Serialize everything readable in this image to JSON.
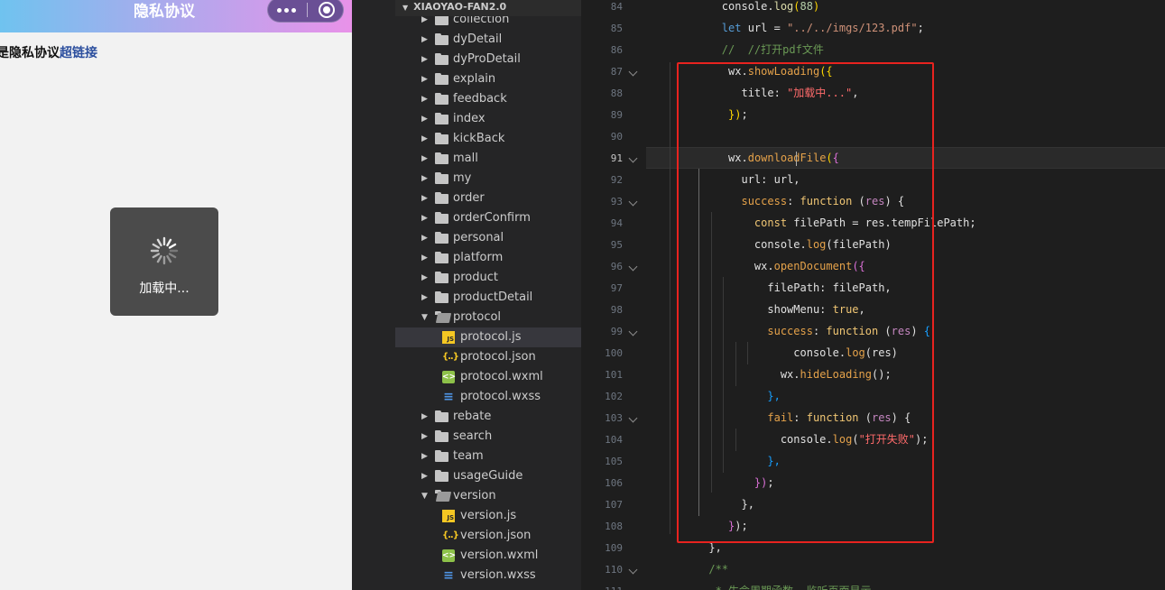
{
  "simulator": {
    "nav_title": "隐私协议",
    "back_glyph": "‹",
    "page_text": "是隐私协议",
    "page_link": "超链接",
    "toast_text": "加载中..."
  },
  "explorer": {
    "project_title": "XIAOYAO-FAN2.0",
    "items": [
      {
        "label": "collection",
        "type": "folder",
        "depth": 0,
        "open": false
      },
      {
        "label": "dyDetail",
        "type": "folder",
        "depth": 0,
        "open": false
      },
      {
        "label": "dyProDetail",
        "type": "folder",
        "depth": 0,
        "open": false
      },
      {
        "label": "explain",
        "type": "folder",
        "depth": 0,
        "open": false
      },
      {
        "label": "feedback",
        "type": "folder",
        "depth": 0,
        "open": false
      },
      {
        "label": "index",
        "type": "folder",
        "depth": 0,
        "open": false
      },
      {
        "label": "kickBack",
        "type": "folder",
        "depth": 0,
        "open": false
      },
      {
        "label": "mall",
        "type": "folder",
        "depth": 0,
        "open": false
      },
      {
        "label": "my",
        "type": "folder",
        "depth": 0,
        "open": false
      },
      {
        "label": "order",
        "type": "folder",
        "depth": 0,
        "open": false
      },
      {
        "label": "orderConfirm",
        "type": "folder",
        "depth": 0,
        "open": false
      },
      {
        "label": "personal",
        "type": "folder",
        "depth": 0,
        "open": false
      },
      {
        "label": "platform",
        "type": "folder",
        "depth": 0,
        "open": false
      },
      {
        "label": "product",
        "type": "folder",
        "depth": 0,
        "open": false
      },
      {
        "label": "productDetail",
        "type": "folder",
        "depth": 0,
        "open": false
      },
      {
        "label": "protocol",
        "type": "folder",
        "depth": 0,
        "open": true
      },
      {
        "label": "protocol.js",
        "type": "js",
        "depth": 1,
        "selected": true
      },
      {
        "label": "protocol.json",
        "type": "json",
        "depth": 1
      },
      {
        "label": "protocol.wxml",
        "type": "wxml",
        "depth": 1
      },
      {
        "label": "protocol.wxss",
        "type": "wxss",
        "depth": 1
      },
      {
        "label": "rebate",
        "type": "folder",
        "depth": 0,
        "open": false
      },
      {
        "label": "search",
        "type": "folder",
        "depth": 0,
        "open": false
      },
      {
        "label": "team",
        "type": "folder",
        "depth": 0,
        "open": false
      },
      {
        "label": "usageGuide",
        "type": "folder",
        "depth": 0,
        "open": false
      },
      {
        "label": "version",
        "type": "folder",
        "depth": 0,
        "open": true
      },
      {
        "label": "version.js",
        "type": "js",
        "depth": 1
      },
      {
        "label": "version.json",
        "type": "json",
        "depth": 1
      },
      {
        "label": "version.wxml",
        "type": "wxml",
        "depth": 1
      },
      {
        "label": "version.wxss",
        "type": "wxss",
        "depth": 1
      }
    ]
  },
  "editor": {
    "current_line": 91,
    "lines": [
      {
        "n": 84,
        "indent": "        ",
        "tokens": [
          [
            "console",
            "var"
          ],
          [
            ".",
            "var"
          ],
          [
            "log",
            "fn"
          ],
          [
            "(",
            "yel"
          ],
          [
            "88",
            "num"
          ],
          [
            ")",
            "yel"
          ]
        ]
      },
      {
        "n": 85,
        "indent": "        ",
        "tokens": [
          [
            "let",
            "kw"
          ],
          [
            " url = ",
            "var"
          ],
          [
            "\"../../imgs/123.pdf\"",
            "str"
          ],
          [
            ";",
            "var"
          ]
        ]
      },
      {
        "n": 86,
        "indent": "        ",
        "tokens": [
          [
            "//  //打开pdf文件",
            "com"
          ]
        ]
      },
      {
        "n": 87,
        "indent": "         ",
        "fold": true,
        "tokens": [
          [
            "wx",
            "var"
          ],
          [
            ".",
            "var"
          ],
          [
            "showLoading",
            "fn2"
          ],
          [
            "({",
            "yel"
          ]
        ]
      },
      {
        "n": 88,
        "indent": "           ",
        "tokens": [
          [
            "title",
            "var"
          ],
          [
            ": ",
            "var"
          ],
          [
            "\"加载中...\"",
            "str2"
          ],
          [
            ",",
            "var"
          ]
        ]
      },
      {
        "n": 89,
        "indent": "         ",
        "tokens": [
          [
            "})",
            "yel"
          ],
          [
            ";",
            "var"
          ]
        ]
      },
      {
        "n": 90,
        "indent": "",
        "tokens": []
      },
      {
        "n": 91,
        "indent": "         ",
        "fold": true,
        "tokens": [
          [
            "wx",
            "var"
          ],
          [
            ".",
            "var"
          ],
          [
            "downloadFile",
            "fn2"
          ],
          [
            "(",
            "yel"
          ],
          [
            "{",
            "pur"
          ]
        ]
      },
      {
        "n": 92,
        "indent": "           ",
        "tokens": [
          [
            "url",
            "var"
          ],
          [
            ": url,",
            "var"
          ]
        ]
      },
      {
        "n": 93,
        "indent": "           ",
        "fold": true,
        "tokens": [
          [
            "success",
            "fn2"
          ],
          [
            ": ",
            "var"
          ],
          [
            "function",
            "field"
          ],
          [
            " (",
            "var"
          ],
          [
            "res",
            "kw2"
          ],
          [
            ") {",
            "var"
          ]
        ]
      },
      {
        "n": 94,
        "indent": "             ",
        "tokens": [
          [
            "const",
            "field"
          ],
          [
            " filePath = res.tempFilePath;",
            "var"
          ]
        ]
      },
      {
        "n": 95,
        "indent": "             ",
        "tokens": [
          [
            "console",
            "var"
          ],
          [
            ".",
            "var"
          ],
          [
            "log",
            "fn2"
          ],
          [
            "(filePath)",
            "var"
          ]
        ]
      },
      {
        "n": 96,
        "indent": "             ",
        "fold": true,
        "tokens": [
          [
            "wx",
            "var"
          ],
          [
            ".",
            "var"
          ],
          [
            "openDocument",
            "fn2"
          ],
          [
            "({",
            "pur"
          ]
        ]
      },
      {
        "n": 97,
        "indent": "               ",
        "tokens": [
          [
            "filePath",
            "var"
          ],
          [
            ": filePath,",
            "var"
          ]
        ]
      },
      {
        "n": 98,
        "indent": "               ",
        "tokens": [
          [
            "showMenu",
            "var"
          ],
          [
            ": ",
            "var"
          ],
          [
            "true",
            "field"
          ],
          [
            ",",
            "var"
          ]
        ]
      },
      {
        "n": 99,
        "indent": "               ",
        "fold": true,
        "tokens": [
          [
            "success",
            "fn2"
          ],
          [
            ": ",
            "var"
          ],
          [
            "function",
            "field"
          ],
          [
            " (",
            "var"
          ],
          [
            "res",
            "kw2"
          ],
          [
            ") ",
            "var"
          ],
          [
            "{",
            "blu"
          ]
        ]
      },
      {
        "n": 100,
        "indent": "                   ",
        "tokens": [
          [
            "console",
            "var"
          ],
          [
            ".",
            "var"
          ],
          [
            "log",
            "fn2"
          ],
          [
            "(res)",
            "var"
          ]
        ]
      },
      {
        "n": 101,
        "indent": "                 ",
        "tokens": [
          [
            "wx",
            "var"
          ],
          [
            ".",
            "var"
          ],
          [
            "hideLoading",
            "fn2"
          ],
          [
            "();",
            "var"
          ]
        ]
      },
      {
        "n": 102,
        "indent": "               ",
        "tokens": [
          [
            "},",
            "blu"
          ]
        ]
      },
      {
        "n": 103,
        "indent": "               ",
        "fold": true,
        "tokens": [
          [
            "fail",
            "fn2"
          ],
          [
            ": ",
            "var"
          ],
          [
            "function",
            "field"
          ],
          [
            " (",
            "var"
          ],
          [
            "res",
            "kw2"
          ],
          [
            ") {",
            "var"
          ]
        ]
      },
      {
        "n": 104,
        "indent": "                 ",
        "tokens": [
          [
            "console",
            "var"
          ],
          [
            ".",
            "var"
          ],
          [
            "log",
            "fn2"
          ],
          [
            "(",
            "var"
          ],
          [
            "\"打开失败\"",
            "str2"
          ],
          [
            ");",
            "var"
          ]
        ]
      },
      {
        "n": 105,
        "indent": "               ",
        "tokens": [
          [
            "},",
            "blu"
          ]
        ]
      },
      {
        "n": 106,
        "indent": "             ",
        "tokens": [
          [
            "})",
            "pur"
          ],
          [
            ";",
            "var"
          ]
        ]
      },
      {
        "n": 107,
        "indent": "           ",
        "tokens": [
          [
            "},",
            "var"
          ]
        ]
      },
      {
        "n": 108,
        "indent": "         ",
        "tokens": [
          [
            "}",
            "pur"
          ],
          [
            ");",
            "var"
          ]
        ]
      },
      {
        "n": 109,
        "indent": "      ",
        "tokens": [
          [
            "},",
            "var"
          ]
        ]
      },
      {
        "n": 110,
        "indent": "      ",
        "fold": true,
        "tokens": [
          [
            "/**",
            "com"
          ]
        ]
      },
      {
        "n": 111,
        "indent": "       ",
        "tokens": [
          [
            "* 生命周期函数--监听页面显示",
            "com"
          ]
        ]
      }
    ]
  },
  "colors": {
    "highlight_box": "#e8231f",
    "nav_gradient_start": "#6fc3ef",
    "nav_gradient_end": "#e992e9"
  }
}
